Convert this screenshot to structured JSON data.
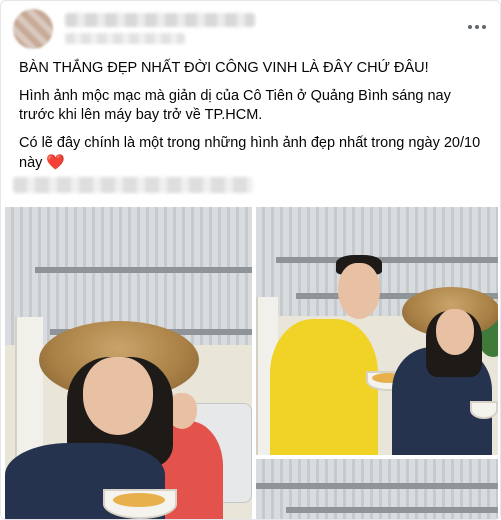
{
  "post": {
    "headline": "BÀN THẮNG ĐẸP NHẤT ĐỜI CÔNG VINH LÀ ĐÂY CHỨ ĐÂU!",
    "paragraph_1": "Hình ảnh mộc mạc mà giản dị của Cô Tiên ở Quảng Bình sáng nay trước khi lên máy bay trở về TP.HCM.",
    "paragraph_2": "Có lẽ đây chính là một trong những hình ảnh đẹp nhất trong ngày 20/10 này",
    "heart_emoji": "❤️"
  },
  "icons": {
    "more": "more-options-icon",
    "heart": "red-heart-emoji"
  },
  "colors": {
    "text": "#050505",
    "border": "#e4e6eb",
    "heart": "#e0245e",
    "more_dots": "#606770"
  }
}
